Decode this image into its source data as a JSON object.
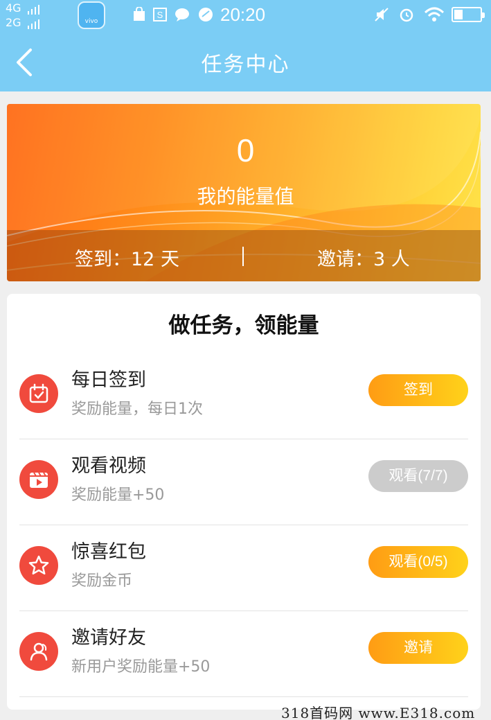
{
  "status_bar": {
    "signal_1": "4G",
    "signal_2": "2G",
    "app_badge": "vivo",
    "time": "20:20",
    "battery_level": 0.2
  },
  "header": {
    "title": "任务中心"
  },
  "energy_card": {
    "value": "0",
    "label": "我的能量值",
    "checkin": "签到：12 天",
    "divider": "|",
    "invite": "邀请：3 人"
  },
  "tasks_panel": {
    "title": "做任务，领能量",
    "tasks": [
      {
        "name": "每日签到",
        "desc": "奖励能量，每日1次",
        "button": "签到",
        "icon": "calendar-icon",
        "enabled": true
      },
      {
        "name": "观看视频",
        "desc": "奖励能量+50",
        "button": "观看(7/7)",
        "icon": "video-icon",
        "enabled": false
      },
      {
        "name": "惊喜红包",
        "desc": "奖励金币",
        "button": "观看(0/5)",
        "icon": "star-icon",
        "enabled": true
      },
      {
        "name": "邀请好友",
        "desc": "新用户奖励能量+50",
        "button": "邀请",
        "icon": "friends-icon",
        "enabled": true
      }
    ]
  },
  "watermark": "318首码网 www.E318.com",
  "colors": {
    "header_bg": "#7bcdf5",
    "icon_red": "#f04a3d",
    "button_gradient_start": "#ff9c14",
    "button_gradient_end": "#ffd21a",
    "button_disabled": "#cccccc"
  }
}
